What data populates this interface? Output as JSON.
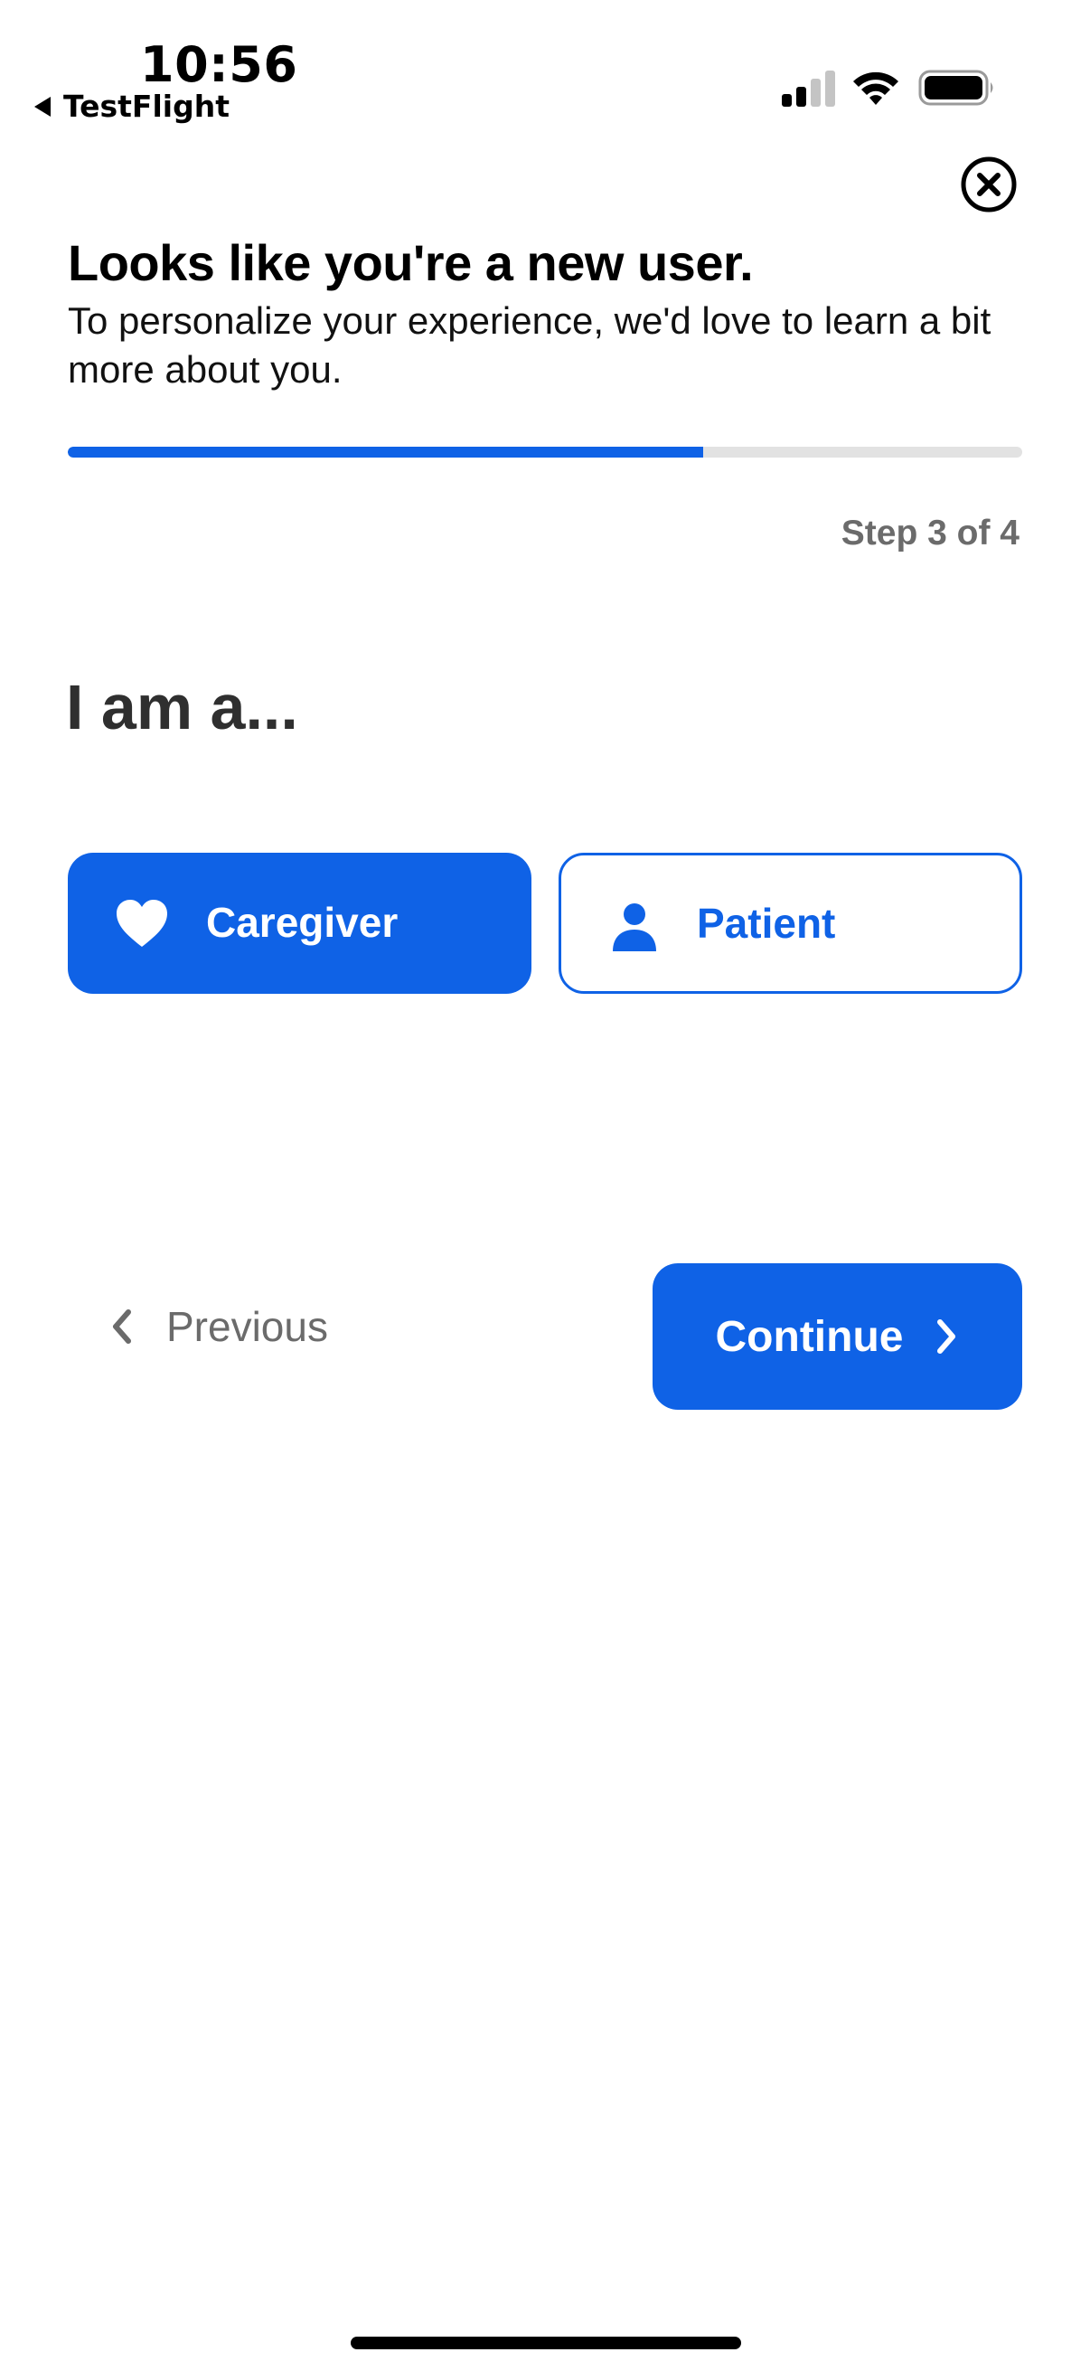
{
  "status_bar": {
    "time": "10:56",
    "back_app": "TestFlight",
    "icons": [
      "cellular-signal-icon",
      "wifi-icon",
      "battery-icon"
    ]
  },
  "header": {
    "close_icon": "close-circle-icon",
    "title": "Looks like you're a new user.",
    "subtitle": "To personalize your experience, we'd love to learn a bit more about you."
  },
  "progress": {
    "fraction": 0.666,
    "step_text": "Step 3 of 4"
  },
  "question": {
    "text": "I am a..."
  },
  "roles": [
    {
      "label": "Caregiver",
      "icon": "heart-icon",
      "selected": true
    },
    {
      "label": "Patient",
      "icon": "person-icon",
      "selected": false
    }
  ],
  "navigation": {
    "previous_label": "Previous",
    "continue_label": "Continue"
  },
  "colors": {
    "accent": "#0f62e6",
    "muted_text": "#6b6b6b",
    "track": "#e2e2e2"
  }
}
